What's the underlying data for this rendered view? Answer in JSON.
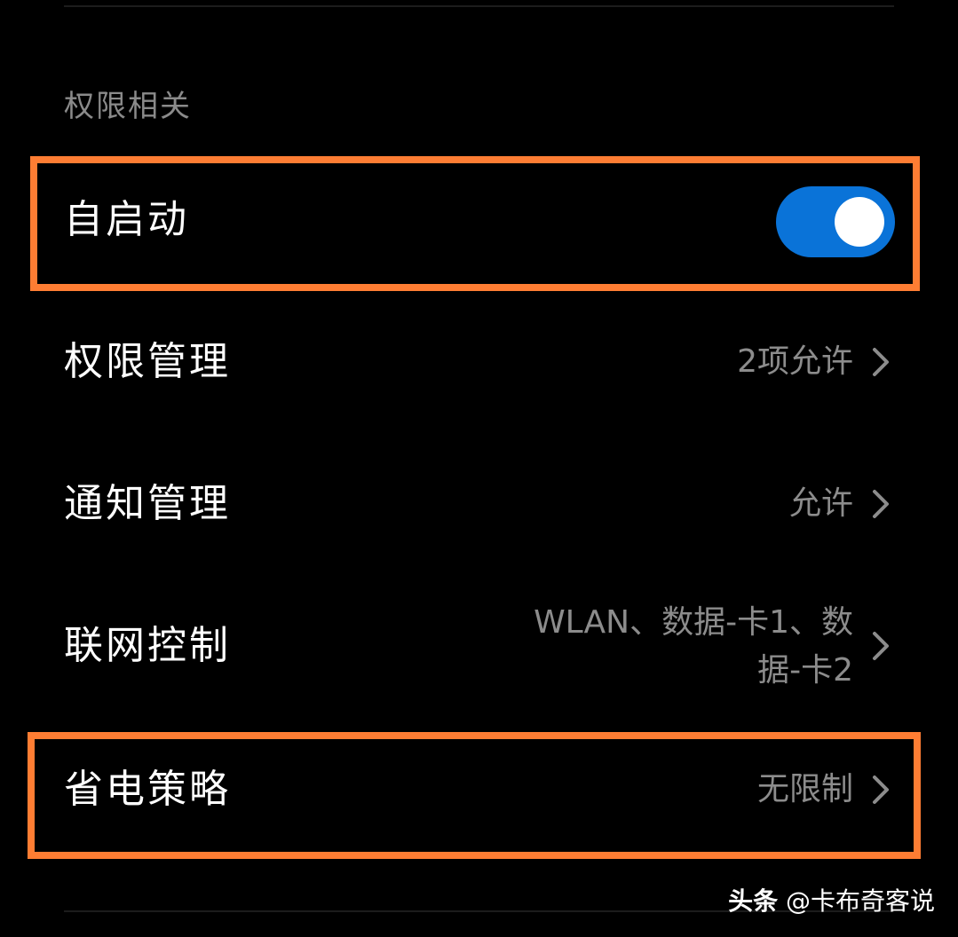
{
  "section": {
    "title": "权限相关"
  },
  "rows": {
    "autostart": {
      "label": "自启动",
      "toggle_on": true
    },
    "permissions": {
      "label": "权限管理",
      "value": "2项允许"
    },
    "notifications": {
      "label": "通知管理",
      "value": "允许"
    },
    "network": {
      "label": "联网控制",
      "value_line1": "WLAN、数据-卡1、数",
      "value_line2": "据-卡2"
    },
    "battery": {
      "label": "省电策略",
      "value": "无限制"
    }
  },
  "watermark": {
    "brand": "头条",
    "handle": "@卡布奇客说"
  },
  "colors": {
    "background": "#000000",
    "toggle_on": "#0a73d8",
    "highlight": "#fe7d33",
    "secondary_text": "#8c8c8c"
  },
  "icons": {
    "chevron": "chevron-right-icon"
  }
}
